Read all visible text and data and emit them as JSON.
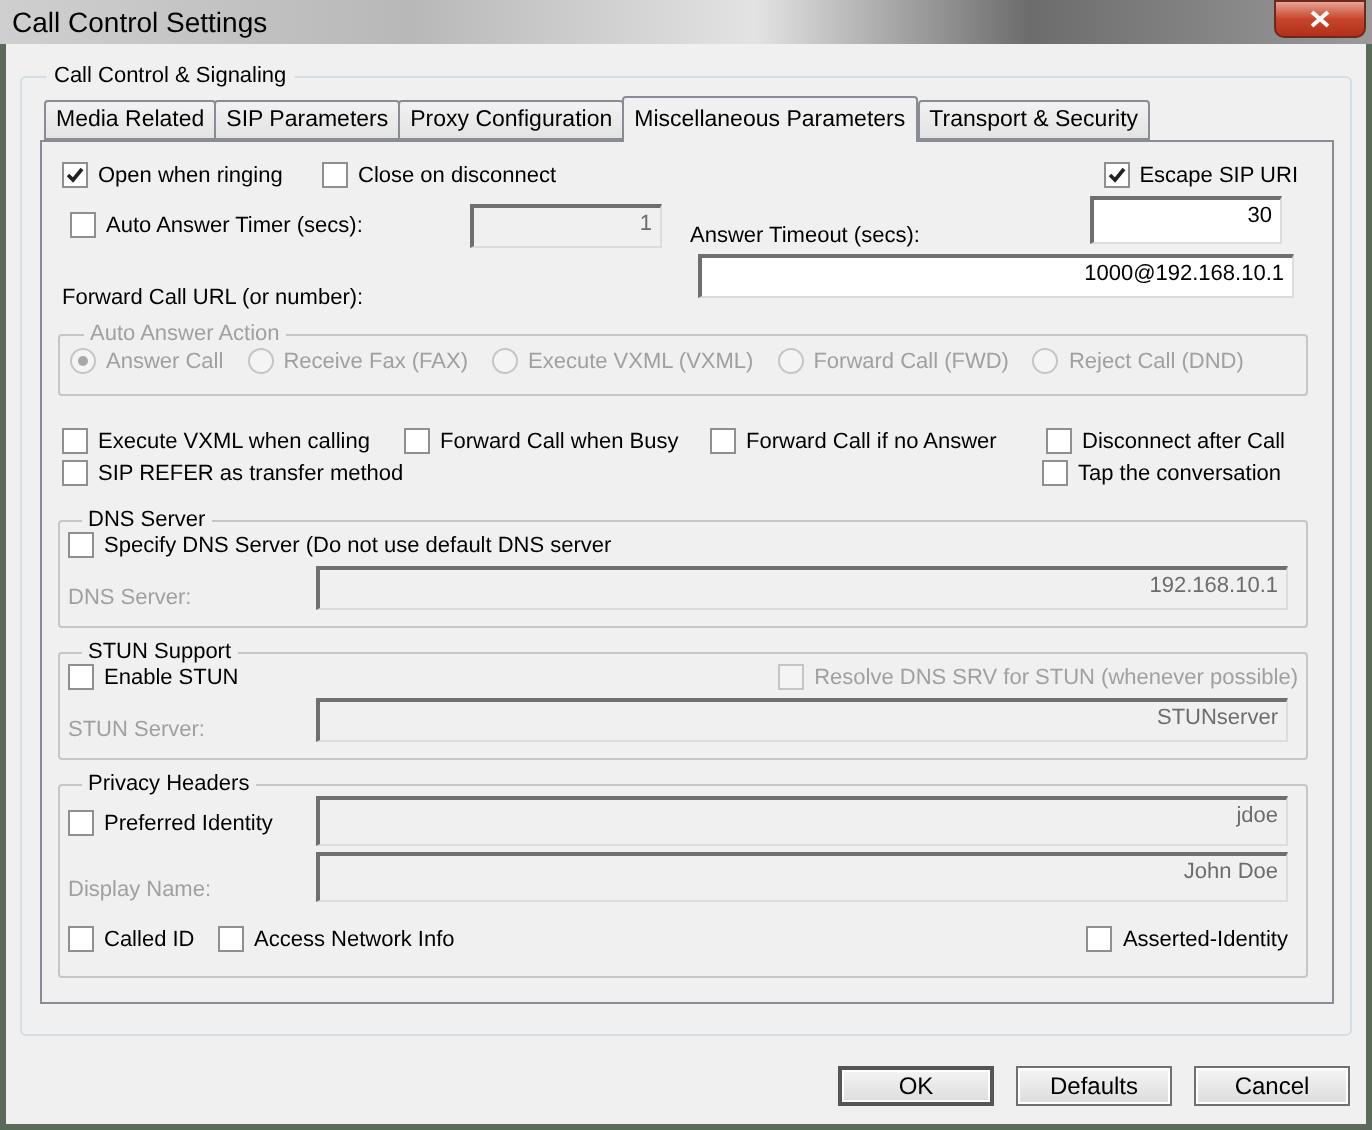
{
  "window": {
    "title": "Call Control Settings"
  },
  "group": {
    "title": "Call Control & Signaling"
  },
  "tabs": [
    {
      "label": "Media Related",
      "selected": false
    },
    {
      "label": "SIP Parameters",
      "selected": false
    },
    {
      "label": "Proxy Configuration",
      "selected": false
    },
    {
      "label": "Miscellaneous Parameters",
      "selected": true
    },
    {
      "label": "Transport & Security",
      "selected": false
    }
  ],
  "top_checks": [
    {
      "label": "Open when ringing",
      "checked": true
    },
    {
      "label": "Close on disconnect",
      "checked": false
    },
    {
      "label": "Escape SIP URI",
      "checked": true
    }
  ],
  "auto_answer_timer": {
    "label": "Auto Answer Timer (secs):",
    "checked": false,
    "value": "1",
    "disabled": true
  },
  "answer_timeout": {
    "label": "Answer Timeout (secs):",
    "value": "30"
  },
  "forward_call_url": {
    "label": "Forward Call URL (or number):",
    "value": "1000@192.168.10.1"
  },
  "auto_answer_action": {
    "title": "Auto Answer Action",
    "disabled": true,
    "options": [
      {
        "label": "Answer Call",
        "selected": true
      },
      {
        "label": "Receive Fax (FAX)",
        "selected": false
      },
      {
        "label": "Execute VXML (VXML)",
        "selected": false
      },
      {
        "label": "Forward Call (FWD)",
        "selected": false
      },
      {
        "label": "Reject Call (DND)",
        "selected": false
      }
    ]
  },
  "call_options": [
    {
      "label": "Execute VXML when calling",
      "checked": false
    },
    {
      "label": "Forward Call when Busy",
      "checked": false
    },
    {
      "label": "Forward Call if no Answer",
      "checked": false
    },
    {
      "label": "Disconnect after Call",
      "checked": false
    },
    {
      "label": "SIP REFER as transfer method",
      "checked": false
    },
    {
      "label": "Tap the conversation",
      "checked": false
    }
  ],
  "dns_server": {
    "title": "DNS Server",
    "specify": {
      "label": "Specify DNS Server (Do not use default DNS server",
      "checked": false
    },
    "field": {
      "label": "DNS Server:",
      "value": "192.168.10.1",
      "disabled": true
    }
  },
  "stun_support": {
    "title": "STUN Support",
    "enable": {
      "label": "Enable STUN",
      "checked": false
    },
    "resolve": {
      "label": "Resolve DNS SRV for STUN (whenever possible)",
      "checked": false,
      "disabled": true
    },
    "field": {
      "label": "STUN Server:",
      "value": "STUNserver",
      "disabled": true
    }
  },
  "privacy_headers": {
    "title": "Privacy Headers",
    "preferred_identity": {
      "label": "Preferred Identity",
      "checked": false,
      "value": "jdoe",
      "disabled": true
    },
    "display_name": {
      "label": "Display Name:",
      "value": "John Doe",
      "disabled": true
    },
    "checks": [
      {
        "label": "Called ID",
        "checked": false
      },
      {
        "label": "Access Network Info",
        "checked": false
      },
      {
        "label": "Asserted-Identity",
        "checked": false
      }
    ]
  },
  "buttons": [
    {
      "label": "OK",
      "default": true
    },
    {
      "label": "Defaults",
      "default": false
    },
    {
      "label": "Cancel",
      "default": false
    }
  ]
}
